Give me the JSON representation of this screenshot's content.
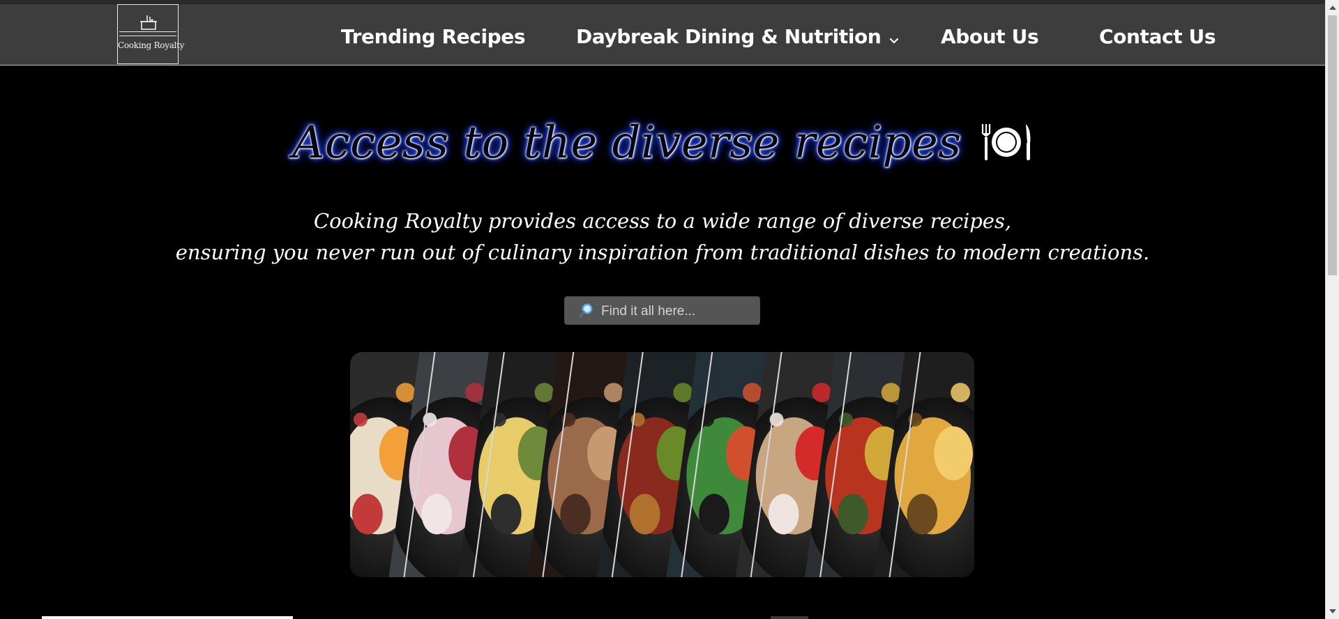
{
  "brand": {
    "logo_text": "Cooking Royalty"
  },
  "nav": {
    "items": [
      {
        "label": "Trending Recipes"
      },
      {
        "label": "Daybreak Dining & Nutrition",
        "has_dropdown": true,
        "icon": "chevron-down-icon"
      },
      {
        "label": "About Us"
      },
      {
        "label": "Contact Us"
      }
    ]
  },
  "hero": {
    "title": "Access to the diverse recipes",
    "title_icon": "plate-cutlery-icon",
    "subtitle_line1": "Cooking Royalty provides access to a wide range of diverse recipes,",
    "subtitle_line2": "ensuring you never run out of culinary inspiration from traditional dishes to modern creations."
  },
  "search": {
    "placeholder": "Find it all here...",
    "value": "",
    "icon": "search-icon"
  },
  "banner": {
    "image": "collage-of-dishes",
    "panels": [
      "sushi",
      "ice-cream-dessert",
      "mashed-dish",
      "braised-meat",
      "grilled-vegetables",
      "salad",
      "fresh-vegetables",
      "roasted-peppers",
      "gratin"
    ]
  },
  "colors": {
    "page_bg": "#000000",
    "nav_bg": "#3d3d3d",
    "title_glow": "#2947ff",
    "search_bg": "#555555"
  }
}
